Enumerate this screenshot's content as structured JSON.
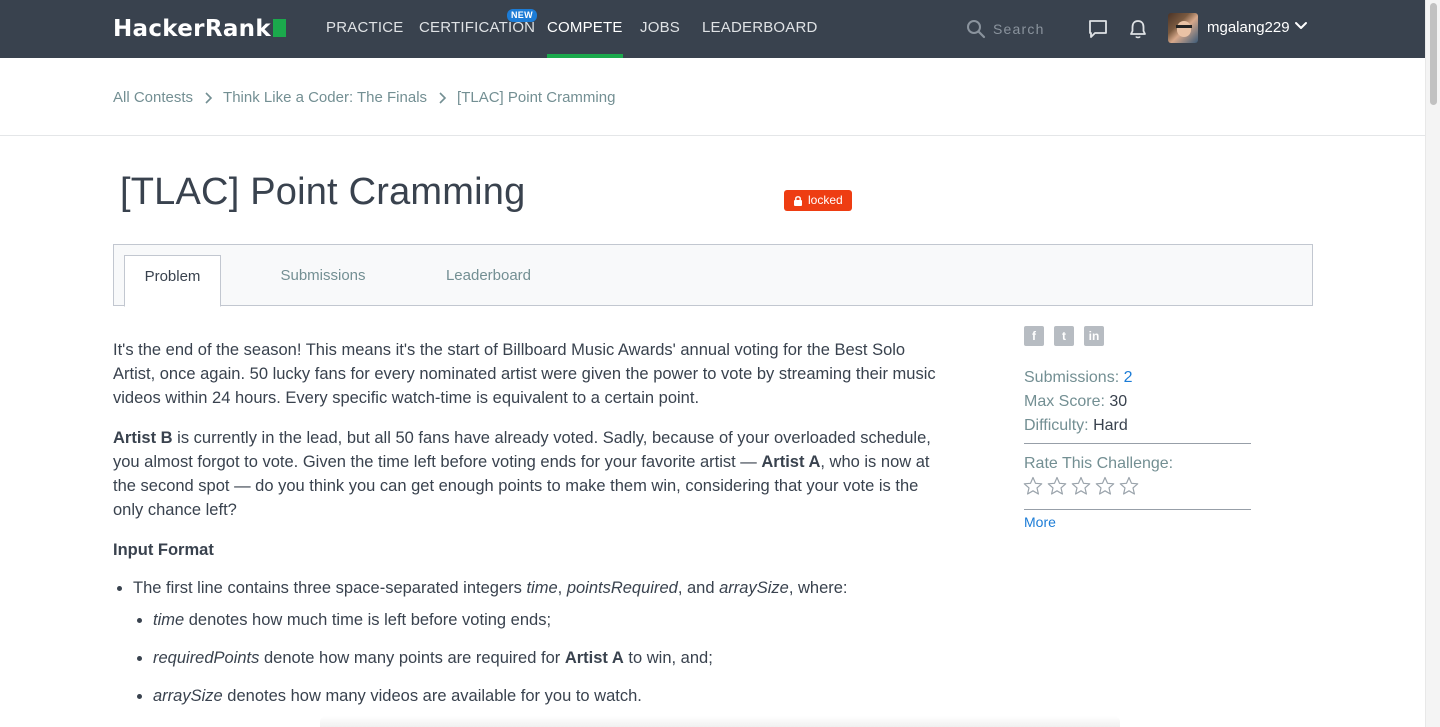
{
  "nav": {
    "logo": "HackerRank",
    "items": [
      {
        "label": "PRACTICE"
      },
      {
        "label": "CERTIFICATION",
        "badge": "NEW"
      },
      {
        "label": "COMPETE",
        "active": true
      },
      {
        "label": "JOBS"
      },
      {
        "label": "LEADERBOARD"
      }
    ],
    "search_placeholder": "Search",
    "username": "mgalang229",
    "icons": [
      "search-icon",
      "chat-icon",
      "bell-icon",
      "chevron-down-icon"
    ],
    "active_color": "#1ba94c"
  },
  "breadcrumb": [
    "All Contests",
    "Think Like a Coder: The Finals",
    "[TLAC] Point Cramming"
  ],
  "title": "[TLAC] Point Cramming",
  "status_badge": "locked",
  "tabs": [
    "Problem",
    "Submissions",
    "Leaderboard"
  ],
  "problem": {
    "p1": "It's the end of the season! This means it's the start of Billboard Music Awards' annual voting for the Best Solo Artist, once again. 50 lucky fans for every nominated artist were given the power to vote by streaming their music videos within 24 hours. Every specific watch-time is equivalent to a certain point.",
    "p2_artist_b": "Artist B",
    "p2_a": " is currently in the lead, but all 50 fans have already voted. Sadly, because of your overloaded schedule, you almost forgot to vote. Given the time left before voting ends for your favorite artist — ",
    "p2_artist_a": "Artist A",
    "p2_b": ", who is now at the second spot — do you think you can get enough points to make them win, considering that your vote is the only chance left?",
    "input_heading": "Input Format",
    "bullet1_pre": "The first line contains three space-separated integers ",
    "bullet1_time": "time",
    "bullet1_comma1": ", ",
    "bullet1_points": "pointsRequired",
    "bullet1_and": ", and ",
    "bullet1_array": "arraySize",
    "bullet1_post": ", where:",
    "sub1_var": "time",
    "sub1_text": " denotes how much time is left before voting ends;",
    "sub2_var": "requiredPoints",
    "sub2_text": " denote how many points are required for ",
    "sub2_artist": "Artist A",
    "sub2_end": " to win, and;",
    "sub3_var": "arraySize",
    "sub3_text": " denotes how many videos are available for you to watch."
  },
  "sidebar": {
    "share_icons": [
      "facebook-icon",
      "twitter-icon",
      "linkedin-icon"
    ],
    "submissions_label": "Submissions:",
    "submissions_value": "2",
    "max_score_label": "Max Score:",
    "max_score_value": "30",
    "difficulty_label": "Difficulty:",
    "difficulty_value": "Hard",
    "rate_label": "Rate This Challenge:",
    "rating": 0,
    "rating_max": 5,
    "more_label": "More"
  }
}
